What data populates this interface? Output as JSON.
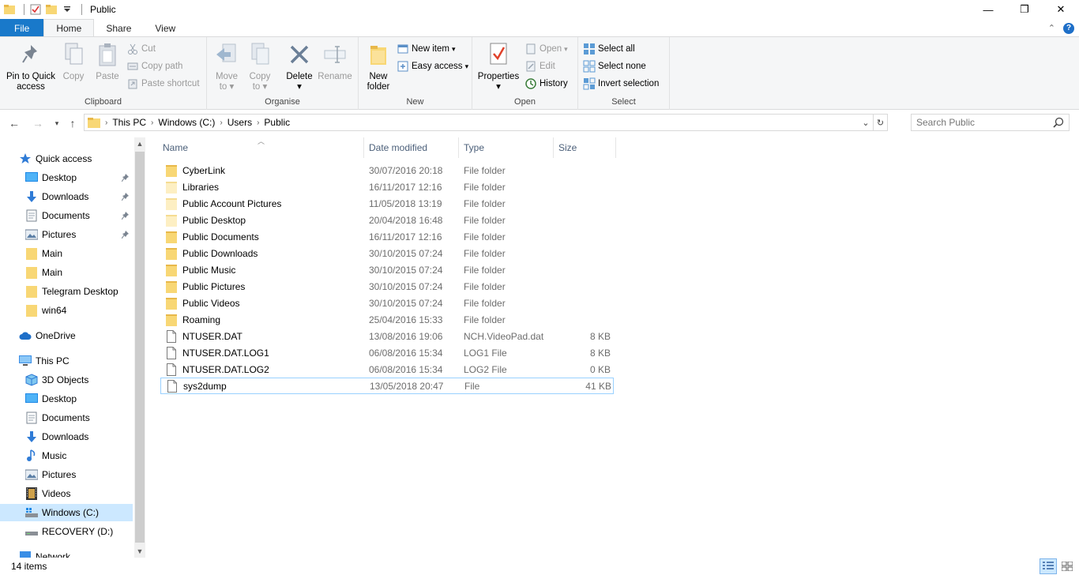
{
  "window": {
    "title": "Public",
    "minimize": "—",
    "maximize": "❐",
    "close": "✕"
  },
  "ribbon_tabs": {
    "file": "File",
    "home": "Home",
    "share": "Share",
    "view": "View"
  },
  "clipboard": {
    "label": "Clipboard",
    "pin_line1": "Pin to Quick",
    "pin_line2": "access",
    "copy": "Copy",
    "paste": "Paste",
    "cut": "Cut",
    "copy_path": "Copy path",
    "paste_shortcut": "Paste shortcut"
  },
  "organise": {
    "label": "Organise",
    "move_line1": "Move",
    "move_line2": "to",
    "copy_line1": "Copy",
    "copy_line2": "to",
    "delete": "Delete",
    "rename": "Rename"
  },
  "new_group": {
    "label": "New",
    "new_folder_line1": "New",
    "new_folder_line2": "folder",
    "new_item": "New item",
    "easy_access": "Easy access"
  },
  "open_group": {
    "label": "Open",
    "properties": "Properties",
    "open": "Open",
    "edit": "Edit",
    "history": "History"
  },
  "select_group": {
    "label": "Select",
    "select_all": "Select all",
    "select_none": "Select none",
    "invert": "Invert selection"
  },
  "address": {
    "crumbs": [
      "This PC",
      "Windows (C:)",
      "Users",
      "Public"
    ]
  },
  "search": {
    "placeholder": "Search Public"
  },
  "nav": {
    "quick_access": "Quick access",
    "quick_items": [
      "Desktop",
      "Downloads",
      "Documents",
      "Pictures",
      "Main",
      "Main",
      "Telegram Desktop",
      "win64"
    ],
    "onedrive": "OneDrive",
    "this_pc": "This PC",
    "pc_items": [
      "3D Objects",
      "Desktop",
      "Documents",
      "Downloads",
      "Music",
      "Pictures",
      "Videos",
      "Windows (C:)",
      "RECOVERY (D:)"
    ],
    "network": "Network"
  },
  "columns": {
    "name": "Name",
    "date": "Date modified",
    "type": "Type",
    "size": "Size"
  },
  "files": [
    {
      "name": "CyberLink",
      "date": "30/07/2016 20:18",
      "type": "File folder",
      "size": "",
      "icon": "folder"
    },
    {
      "name": "Libraries",
      "date": "16/11/2017 12:16",
      "type": "File folder",
      "size": "",
      "icon": "folder-light"
    },
    {
      "name": "Public Account Pictures",
      "date": "11/05/2018 13:19",
      "type": "File folder",
      "size": "",
      "icon": "folder-light"
    },
    {
      "name": "Public Desktop",
      "date": "20/04/2018 16:48",
      "type": "File folder",
      "size": "",
      "icon": "folder-light"
    },
    {
      "name": "Public Documents",
      "date": "16/11/2017 12:16",
      "type": "File folder",
      "size": "",
      "icon": "folder"
    },
    {
      "name": "Public Downloads",
      "date": "30/10/2015 07:24",
      "type": "File folder",
      "size": "",
      "icon": "folder"
    },
    {
      "name": "Public Music",
      "date": "30/10/2015 07:24",
      "type": "File folder",
      "size": "",
      "icon": "folder"
    },
    {
      "name": "Public Pictures",
      "date": "30/10/2015 07:24",
      "type": "File folder",
      "size": "",
      "icon": "folder"
    },
    {
      "name": "Public Videos",
      "date": "30/10/2015 07:24",
      "type": "File folder",
      "size": "",
      "icon": "folder"
    },
    {
      "name": "Roaming",
      "date": "25/04/2016 15:33",
      "type": "File folder",
      "size": "",
      "icon": "folder"
    },
    {
      "name": "NTUSER.DAT",
      "date": "13/08/2016 19:06",
      "type": "NCH.VideoPad.dat",
      "size": "8 KB",
      "icon": "file"
    },
    {
      "name": "NTUSER.DAT.LOG1",
      "date": "06/08/2016 15:34",
      "type": "LOG1 File",
      "size": "8 KB",
      "icon": "file"
    },
    {
      "name": "NTUSER.DAT.LOG2",
      "date": "06/08/2016 15:34",
      "type": "LOG2 File",
      "size": "0 KB",
      "icon": "file"
    },
    {
      "name": "sys2dump",
      "date": "13/05/2018 20:47",
      "type": "File",
      "size": "41 KB",
      "icon": "file"
    }
  ],
  "status": {
    "count": "14 items"
  },
  "colors": {
    "accent": "#1979ca",
    "folder": "#f8d775",
    "selected": "#cce8ff"
  }
}
